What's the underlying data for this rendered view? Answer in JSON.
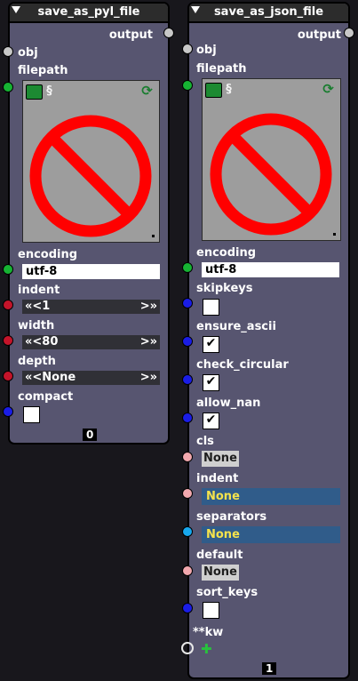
{
  "node_left": {
    "title": "save_as_pyl_file",
    "output_label": "output",
    "obj_label": "obj",
    "filepath_label": "filepath",
    "filepath_preview_icon": "prohibited-sign",
    "toolbar": {
      "open_icon": "folder-open-icon",
      "view_icon": "scroll-icon",
      "reload_icon": "reload-icon"
    },
    "encoding_label": "encoding",
    "encoding_value": "utf-8",
    "indent_label": "indent",
    "indent_value": "1",
    "width_label": "width",
    "width_value": "80",
    "depth_label": "depth",
    "depth_value": "None",
    "compact_label": "compact",
    "compact_checked": false,
    "index": "0",
    "spin_left": "«<",
    "spin_right": ">»"
  },
  "node_right": {
    "title": "save_as_json_file",
    "output_label": "output",
    "obj_label": "obj",
    "filepath_label": "filepath",
    "filepath_preview_icon": "prohibited-sign",
    "toolbar": {
      "open_icon": "folder-open-icon",
      "view_icon": "scroll-icon",
      "reload_icon": "reload-icon"
    },
    "encoding_label": "encoding",
    "encoding_value": "utf-8",
    "skipkeys_label": "skipkeys",
    "skipkeys_checked": false,
    "ensure_ascii_label": "ensure_ascii",
    "ensure_ascii_checked": true,
    "check_circular_label": "check_circular",
    "check_circular_checked": true,
    "allow_nan_label": "allow_nan",
    "allow_nan_checked": true,
    "cls_label": "cls",
    "cls_value": "None",
    "indent_label": "indent",
    "indent_value": "None",
    "separators_label": "separators",
    "separators_value": "None",
    "default_label": "default",
    "default_value": "None",
    "sort_keys_label": "sort_keys",
    "sort_keys_checked": false,
    "kw_label": "**kw",
    "index": "1"
  },
  "colors": {
    "node_body": "#575570",
    "header": "#2c2c2c",
    "socket_green": "#16b333",
    "socket_red": "#c4142a",
    "socket_blue": "#1a1de6",
    "socket_pink": "#f2a8ae",
    "socket_cyan": "#17a8ee",
    "prohibit_red": "#ff0000"
  }
}
